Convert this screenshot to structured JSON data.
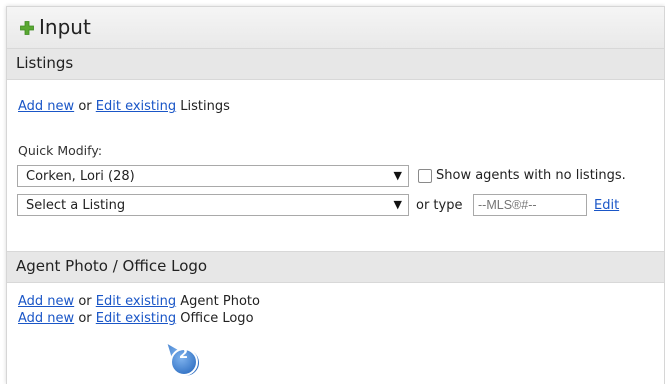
{
  "header": {
    "title": "Input",
    "icon": "plus-icon",
    "icon_color": "#5aa832"
  },
  "listings": {
    "heading": "Listings",
    "add_new": "Add new",
    "or": "or",
    "edit_existing": "Edit existing",
    "suffix": "Listings",
    "quick_modify_label": "Quick Modify:",
    "agent_select_value": "Corken, Lori (28)",
    "listing_select_value": "Select a Listing",
    "show_agents_label": "Show agents with no listings.",
    "or_type": "or type",
    "mls_placeholder": "--MLS®#--",
    "edit_label": "Edit"
  },
  "photo_logo": {
    "heading": "Agent Photo / Office Logo",
    "row1": {
      "add_new": "Add new",
      "or": "or",
      "edit_existing": "Edit existing",
      "suffix": "Agent Photo"
    },
    "row2": {
      "add_new": "Add new",
      "or": "or",
      "edit_existing": "Edit existing",
      "suffix": "Office Logo"
    }
  },
  "callout": {
    "number": "2",
    "color": "#3a7fd0"
  },
  "colors": {
    "link": "#1a56c7",
    "section_bg": "#e7e7e7"
  }
}
